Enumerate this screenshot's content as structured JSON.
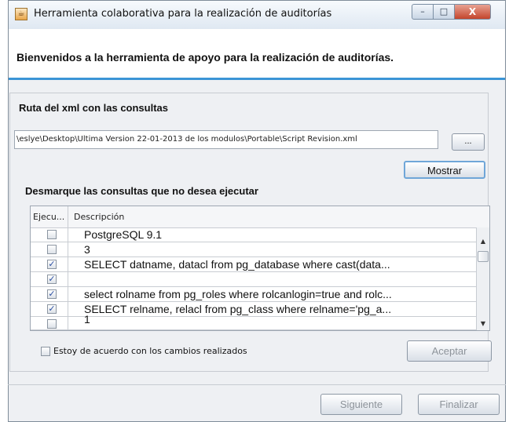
{
  "window": {
    "title": "Herramienta colaborativa para la realización de auditorías",
    "app_icon": "java-cup-icon"
  },
  "header": {
    "welcome": "Bienvenidos a la herramienta de apoyo para la realización de auditorías."
  },
  "xml_section": {
    "label": "Ruta del xml con las consultas",
    "path_value": "\\eslye\\Desktop\\Ultima Version 22-01-2013 de los modulos\\Portable\\Script Revision.xml",
    "browse_label": "...",
    "show_label": "Mostrar"
  },
  "queries": {
    "label": "Desmarque las consultas que no desea ejecutar",
    "columns": [
      "Ejecu...",
      "Descripción"
    ],
    "rows": [
      {
        "checked": false,
        "description": "PostgreSQL 9.1"
      },
      {
        "checked": false,
        "description": "3"
      },
      {
        "checked": true,
        "description": "SELECT datname, datacl from pg_database where cast(data..."
      },
      {
        "checked": true,
        "description": ""
      },
      {
        "checked": true,
        "description": "select rolname from pg_roles where rolcanlogin=true and rolc..."
      },
      {
        "checked": true,
        "description": "SELECT relname, relacl from pg_class where relname='pg_a..."
      },
      {
        "checked": false,
        "description": "1"
      }
    ]
  },
  "agreement": {
    "label": "Estoy de acuerdo con los cambios realizados",
    "checked": false
  },
  "buttons": {
    "accept": "Aceptar",
    "next": "Siguiente",
    "finish": "Finalizar"
  },
  "controls": {
    "minimize": "–",
    "maximize": "□",
    "close": "X"
  },
  "colors": {
    "accent_rule": "#3b95d6",
    "close_button": "#c4452c"
  }
}
